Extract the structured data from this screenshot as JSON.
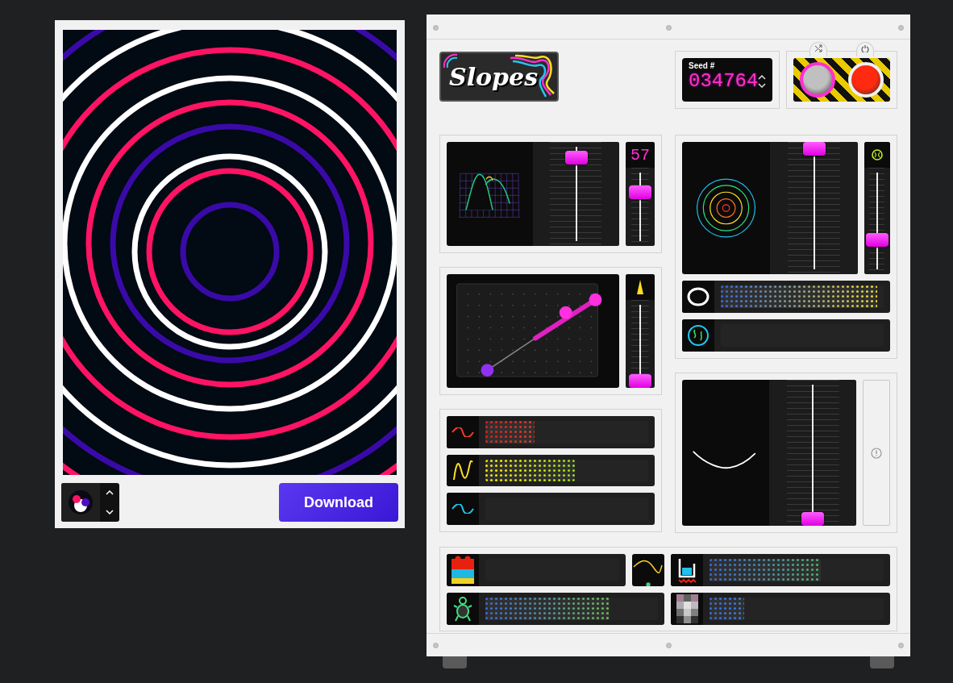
{
  "artwork": {
    "download": "Download"
  },
  "header": {
    "logo": "Slopes",
    "seed": {
      "label": "Seed #",
      "value": "034764"
    }
  },
  "graph_panel": {
    "main_slider": {
      "level": 0.9
    },
    "counter": "57",
    "side_slider": {
      "level": 0.72
    }
  },
  "path_panel": {
    "slider": {
      "level": 0
    }
  },
  "wave_meters": [
    {
      "kind": "sine",
      "level": 0.3
    },
    {
      "kind": "zigzag",
      "level": 0.55
    },
    {
      "kind": "wave",
      "level": 0
    }
  ],
  "rings_panel": {
    "main_slider": {
      "level": 1
    },
    "side_slider": {
      "level": 0.3
    },
    "meters": [
      {
        "kind": "ring",
        "level": 0.96
      },
      {
        "kind": "globe",
        "level": 0
      }
    ]
  },
  "curve_panel": {
    "slider": {
      "level": 0
    }
  },
  "bottom_meters": [
    {
      "kind": "blocks",
      "level": 0
    },
    {
      "kind": "beaker",
      "level": 0.64
    },
    {
      "kind": "turtle",
      "level": 0.72
    },
    {
      "kind": "pixels",
      "level": 0.2
    }
  ]
}
